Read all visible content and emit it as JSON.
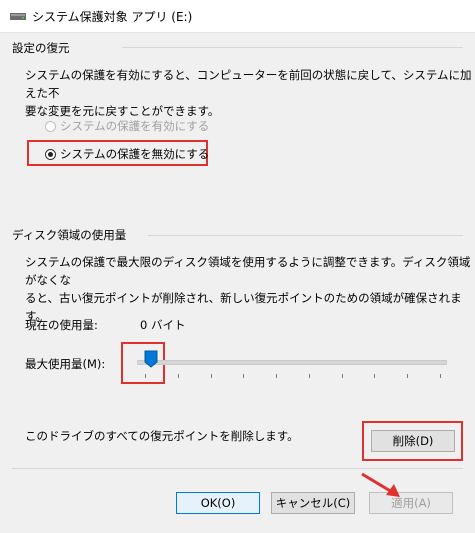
{
  "window": {
    "title": "システム保護対象 アプリ (E:)",
    "icon": "drive-icon"
  },
  "restore_settings": {
    "header": "設定の復元",
    "description_line1": "システムの保護を有効にすると、コンピューターを前回の状態に戻して、システムに加えた不",
    "description_line2": "要な変更を元に戻すことができます。",
    "enable_option": "システムの保護を有効にする",
    "disable_option": "システムの保護を無効にする",
    "selected": "disable"
  },
  "disk_usage": {
    "header": "ディスク領域の使用量",
    "description_line1": "システムの保護で最大限のディスク領域を使用するように調整できます。ディスク領域がなくな",
    "description_line2": "ると、古い復元ポイントが削除され、新しい復元ポイントのための領域が確保されます。",
    "current_label": "現在の使用量:",
    "current_value": "0 バイト",
    "max_label": "最大使用量(M):",
    "slider_value_fraction": 0.02
  },
  "delete_section": {
    "description": "このドライブのすべての復元ポイントを削除します。",
    "delete_button": "削除(D)"
  },
  "buttons": {
    "ok": "OK(O)",
    "cancel": "キャンセル(C)",
    "apply": "適用(A)"
  },
  "colors": {
    "highlight_red": "#e03131",
    "default_button_border": "#0078d7"
  }
}
